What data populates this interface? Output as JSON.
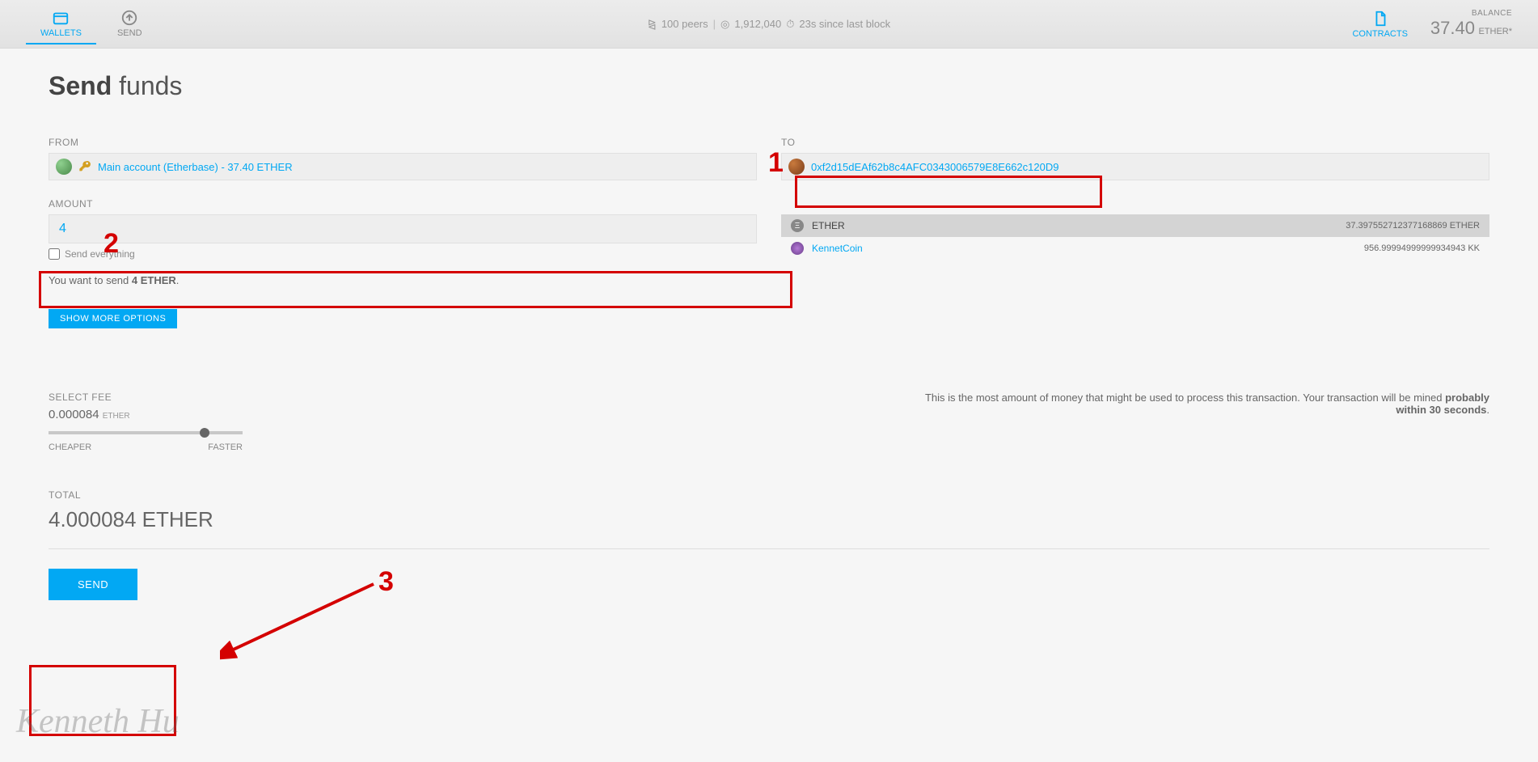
{
  "nav": {
    "wallets": "WALLETS",
    "send": "SEND",
    "contracts": "CONTRACTS"
  },
  "status": {
    "peers": "100 peers",
    "block": "1,912,040",
    "since": "23s since last block"
  },
  "balance": {
    "label": "BALANCE",
    "value": "37.40",
    "unit": "ETHER*"
  },
  "page": {
    "title_bold": "Send",
    "title_light": "funds"
  },
  "from": {
    "label": "FROM",
    "account": "Main account (Etherbase) - 37.40 ETHER"
  },
  "to": {
    "label": "TO",
    "address": "0xf2d15dEAf62b8c4AFC0343006579E8E662c120D9"
  },
  "amount": {
    "label": "AMOUNT",
    "value": "4",
    "send_everything": "Send everything",
    "summary_prefix": "You want to send ",
    "summary_bold": "4 ETHER",
    "summary_suffix": "."
  },
  "tokens": {
    "ether": {
      "name": "ETHER",
      "balance": "37.397552712377168869 ETHER"
    },
    "kennet": {
      "name": "KennetCoin",
      "balance": "956.99994999999934943 KK"
    }
  },
  "buttons": {
    "show_more": "SHOW MORE OPTIONS",
    "send": "SEND"
  },
  "fee": {
    "label": "SELECT FEE",
    "value": "0.000084",
    "unit": "ETHER",
    "cheaper": "CHEAPER",
    "faster": "FASTER",
    "right_text_a": "This is the most amount of money that might be used to process this transaction. Your transaction will be mined ",
    "right_text_b": "probably within 30 seconds",
    "right_text_c": "."
  },
  "total": {
    "label": "TOTAL",
    "value": "4.000084 ETHER"
  },
  "annotations": {
    "n1": "1",
    "n2": "2",
    "n3": "3",
    "watermark": "Kenneth Hu"
  }
}
